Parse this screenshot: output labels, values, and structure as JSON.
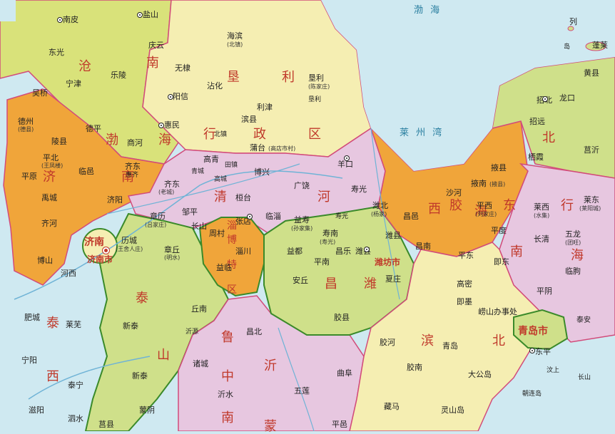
{
  "colors": {
    "sea": "#cfe9f1",
    "cangnan": "#d9e27a",
    "kenli": "#f5eeb2",
    "jiyu": "#f0a53a",
    "qinghe": "#e7c7e0",
    "taishan": "#cfe08a",
    "zibo": "#f0a53a",
    "weifang": "#cfe08a",
    "jiaodong": "#f0a53a",
    "binbei": "#f5eeb2",
    "qingdao": "#cfe08a",
    "region_name": "#c0392b",
    "boundary": "#d24b7a",
    "river": "#6fb3d6"
  },
  "region_names": [
    "沧",
    "南",
    "垦",
    "利",
    "渤",
    "海",
    "行",
    "政",
    "区",
    "清",
    "河",
    "淄",
    "博",
    "特",
    "区",
    "济",
    "南",
    "市",
    "泰",
    "山",
    "鲁",
    "中",
    "南",
    "沂",
    "昌",
    "潍",
    "潍坊市",
    "胶",
    "东",
    "海",
    "行",
    "海",
    "南",
    "西",
    "北",
    "滨",
    "北",
    "青岛市",
    "西",
    "蒙",
    "济南市",
    "北",
    "北",
    "泰"
  ],
  "seas": [
    "渤 海",
    "莱 州 湾"
  ],
  "cities_special": [
    "济南",
    "青岛市",
    "潍坊市"
  ],
  "places": [
    {
      "name": "南皮"
    },
    {
      "name": "盐山"
    },
    {
      "name": "庆云"
    },
    {
      "name": "海滨",
      "sub": "(北镇)"
    },
    {
      "name": "东光"
    },
    {
      "name": "无棣"
    },
    {
      "name": "乐陵"
    },
    {
      "name": "宁津"
    },
    {
      "name": "沾化"
    },
    {
      "name": "吴桥"
    },
    {
      "name": "阳信"
    },
    {
      "name": "垦利",
      "sub": "(陈家庄)"
    },
    {
      "name": "垦利"
    },
    {
      "name": "德州",
      "sub": "(德县)"
    },
    {
      "name": "陵县"
    },
    {
      "name": "德平"
    },
    {
      "name": "惠民"
    },
    {
      "name": "利津"
    },
    {
      "name": "滨县"
    },
    {
      "name": "北镇"
    },
    {
      "name": "商河"
    },
    {
      "name": "蒲台",
      "sub": "(高店市村)"
    },
    {
      "name": "平北",
      "sub": "(王凤楼)"
    },
    {
      "name": "临邑"
    },
    {
      "name": "齐东"
    },
    {
      "name": "惠齐"
    },
    {
      "name": "高青"
    },
    {
      "name": "田镇"
    },
    {
      "name": "博兴"
    },
    {
      "name": "羊口"
    },
    {
      "name": "平原"
    },
    {
      "name": "禹城"
    },
    {
      "name": "济阳"
    },
    {
      "name": "青城"
    },
    {
      "name": "高城"
    },
    {
      "name": "广饶"
    },
    {
      "name": "寿光"
    },
    {
      "name": "齐河"
    },
    {
      "name": "齐东",
      "sub": "(老城)"
    },
    {
      "name": "邹平"
    },
    {
      "name": "桓台"
    },
    {
      "name": "临淄"
    },
    {
      "name": "益寿",
      "sub": "(孙家集)"
    },
    {
      "name": "寿光",
      "sub": "(上口)"
    },
    {
      "name": "潍北",
      "sub": "(杨家)"
    },
    {
      "name": "昌邑"
    },
    {
      "name": "沙河"
    },
    {
      "name": "掖南",
      "sub": "(掖县)"
    },
    {
      "name": "掖县"
    },
    {
      "name": "莱西",
      "sub": "(水集)"
    },
    {
      "name": "莱东",
      "sub": "(莱阳城)"
    },
    {
      "name": "章历",
      "sub": "(吕家庄)"
    },
    {
      "name": "长山"
    },
    {
      "name": "周村"
    },
    {
      "name": "张店"
    },
    {
      "name": "益都"
    },
    {
      "name": "寿南",
      "sub": "(寿光)"
    },
    {
      "name": "潍县"
    },
    {
      "name": "昌南"
    },
    {
      "name": "平西",
      "sub": "(刘家庄)"
    },
    {
      "name": "平度"
    },
    {
      "name": "五龙",
      "sub": "(团旺)"
    },
    {
      "name": "济南"
    },
    {
      "name": "历城",
      "sub": "(王舍人庄)"
    },
    {
      "name": "章丘",
      "sub": "(明水)"
    },
    {
      "name": "淄川"
    },
    {
      "name": "昌乐"
    },
    {
      "name": "潍县",
      "sub": "(坊子)"
    },
    {
      "name": "昌南"
    },
    {
      "name": "莱阳"
    },
    {
      "name": "长清"
    },
    {
      "name": "河西"
    },
    {
      "name": "博山"
    },
    {
      "name": "益临",
      "sub": "(谷县)"
    },
    {
      "name": "平南"
    },
    {
      "name": "平东"
    },
    {
      "name": "即东"
    },
    {
      "name": "临朐"
    },
    {
      "name": "安丘"
    },
    {
      "name": "夏庄"
    },
    {
      "name": "高密"
    },
    {
      "name": "即墨"
    },
    {
      "name": "平阴"
    },
    {
      "name": "肥城"
    },
    {
      "name": "莱芜"
    },
    {
      "name": "丘南"
    },
    {
      "name": "胶县"
    },
    {
      "name": "崂山办事处"
    },
    {
      "name": "泰安"
    },
    {
      "name": "新泰"
    },
    {
      "name": "沂源"
    },
    {
      "name": "昌北"
    },
    {
      "name": "胶河"
    },
    {
      "name": "青岛"
    },
    {
      "name": "东平"
    },
    {
      "name": "宁阳"
    },
    {
      "name": "泰宁"
    },
    {
      "name": "新泰"
    },
    {
      "name": "诸城"
    },
    {
      "name": "胶南"
    },
    {
      "name": "大公岛"
    },
    {
      "name": "汶上"
    },
    {
      "name": "滋阳"
    },
    {
      "name": "泗水"
    },
    {
      "name": "蒙阴"
    },
    {
      "name": "沂水"
    },
    {
      "name": "五莲"
    },
    {
      "name": "藏马"
    },
    {
      "name": "灵山岛"
    },
    {
      "name": "朝连岛"
    },
    {
      "name": "长山"
    },
    {
      "name": "蓬莱"
    },
    {
      "name": "黄县"
    },
    {
      "name": "龙口"
    },
    {
      "name": "招北"
    },
    {
      "name": "招远"
    },
    {
      "name": "栖霞"
    },
    {
      "name": "莒沂"
    },
    {
      "name": "曲阜"
    },
    {
      "name": "莒县"
    },
    {
      "name": "平邑"
    }
  ],
  "legend_text": [
    "列",
    "岛"
  ]
}
